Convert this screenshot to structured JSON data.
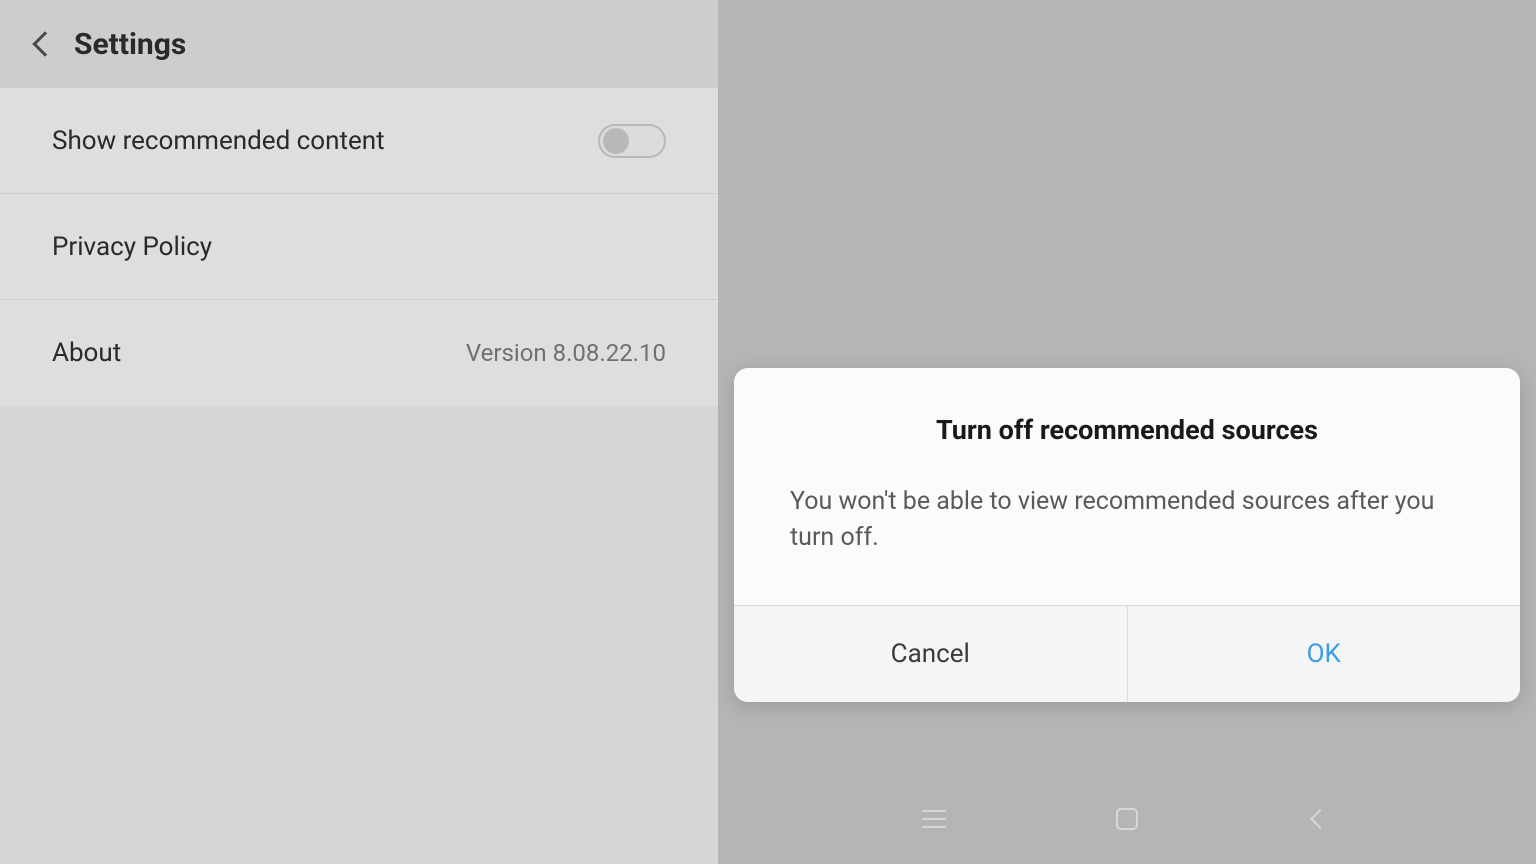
{
  "header": {
    "title": "Settings"
  },
  "rows": {
    "recommended": "Show recommended content",
    "privacy": "Privacy Policy",
    "about": "About",
    "version": "Version 8.08.22.10"
  },
  "dialog": {
    "title": "Turn off recommended sources",
    "message": "You won't be able to view recommended sources after you turn off.",
    "cancel": "Cancel",
    "ok": "OK"
  }
}
